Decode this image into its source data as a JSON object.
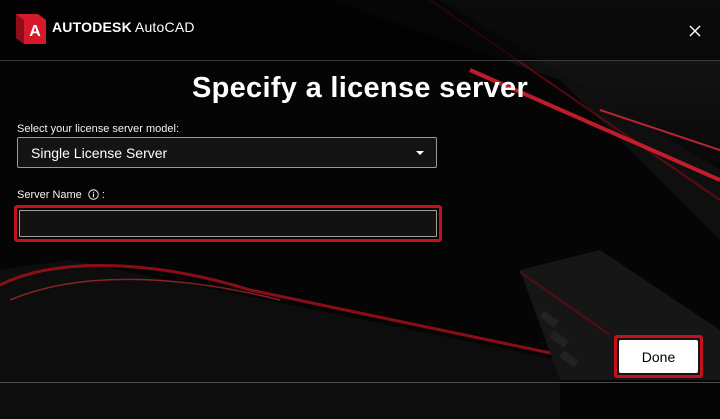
{
  "window": {
    "brand_company": "AUTODESK",
    "brand_product": "AutoCAD",
    "logo_letter": "A",
    "close_icon": "close-icon"
  },
  "dialog": {
    "heading": "Specify a license server",
    "model_label": "Select your license server model:",
    "model_selected": "Single License Server",
    "server_name_label": "Server Name",
    "server_name_label_suffix": ":",
    "server_name_value": "",
    "info_icon": "info-icon"
  },
  "footer": {
    "done_label": "Done"
  },
  "colors": {
    "accent_red": "#c4111b",
    "logo_red": "#d4192b",
    "background": "#050505"
  }
}
